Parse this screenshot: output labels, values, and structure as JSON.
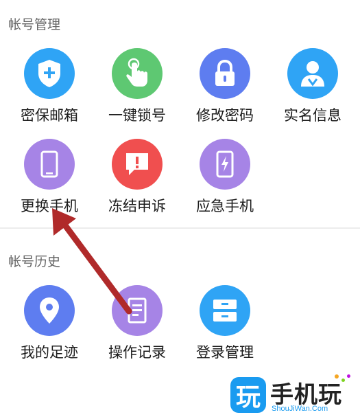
{
  "sections": {
    "account_title": "帐号管理",
    "history_title": "帐号历史"
  },
  "account_items": [
    {
      "label": "密保邮箱",
      "icon": "shield-plus-icon",
      "color": "#2fa4f5"
    },
    {
      "label": "一键锁号",
      "icon": "tap-hand-icon",
      "color": "#5ec872"
    },
    {
      "label": "修改密码",
      "icon": "lock-icon",
      "color": "#5e7df0"
    },
    {
      "label": "实名信息",
      "icon": "id-person-icon",
      "color": "#2fa4f5"
    },
    {
      "label": "更换手机",
      "icon": "phone-icon",
      "color": "#a684e6"
    },
    {
      "label": "冻结申诉",
      "icon": "alert-message-icon",
      "color": "#f04f4f"
    },
    {
      "label": "应急手机",
      "icon": "emergency-phone-icon",
      "color": "#a684e6"
    }
  ],
  "history_items": [
    {
      "label": "我的足迹",
      "icon": "location-pin-icon",
      "color": "#5e7df0"
    },
    {
      "label": "操作记录",
      "icon": "document-icon",
      "color": "#a684e6"
    },
    {
      "label": "登录管理",
      "icon": "drawer-icon",
      "color": "#2fa4f5"
    }
  ],
  "annotation": {
    "color": "#b02a2a",
    "icon": "arrow-icon"
  },
  "watermark": {
    "brand": "手机玩",
    "badge": "玩",
    "url": "ShouJiWan.Com"
  }
}
